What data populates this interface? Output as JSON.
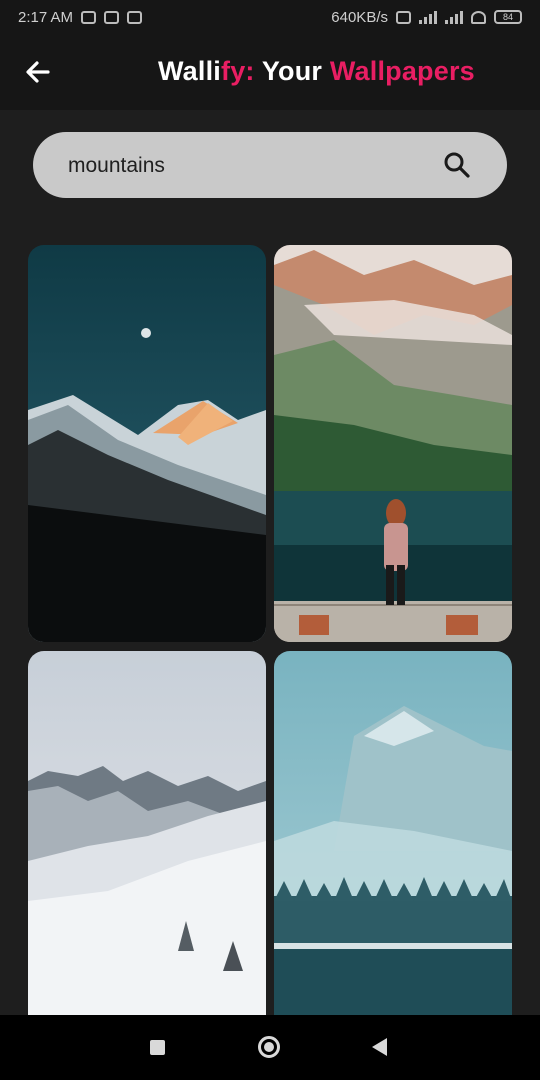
{
  "status_bar": {
    "time": "2:17 AM",
    "speed": "640KB/s",
    "battery": "84"
  },
  "header": {
    "title_part1": "Walli",
    "title_part2": "fy:",
    "title_part3": " Your ",
    "title_part4": "Wallpapers",
    "accent_color": "#e91e63"
  },
  "search": {
    "value": "mountains",
    "placeholder": "Search"
  },
  "wallpapers": [
    {
      "subject": "dark snowy peak with moon at dusk"
    },
    {
      "subject": "woman on pier at alpine lake"
    },
    {
      "subject": "snow covered mountain range"
    },
    {
      "subject": "misty mountain over forest lake"
    }
  ],
  "nav": {
    "buttons": [
      "recent-apps",
      "home",
      "back"
    ]
  }
}
